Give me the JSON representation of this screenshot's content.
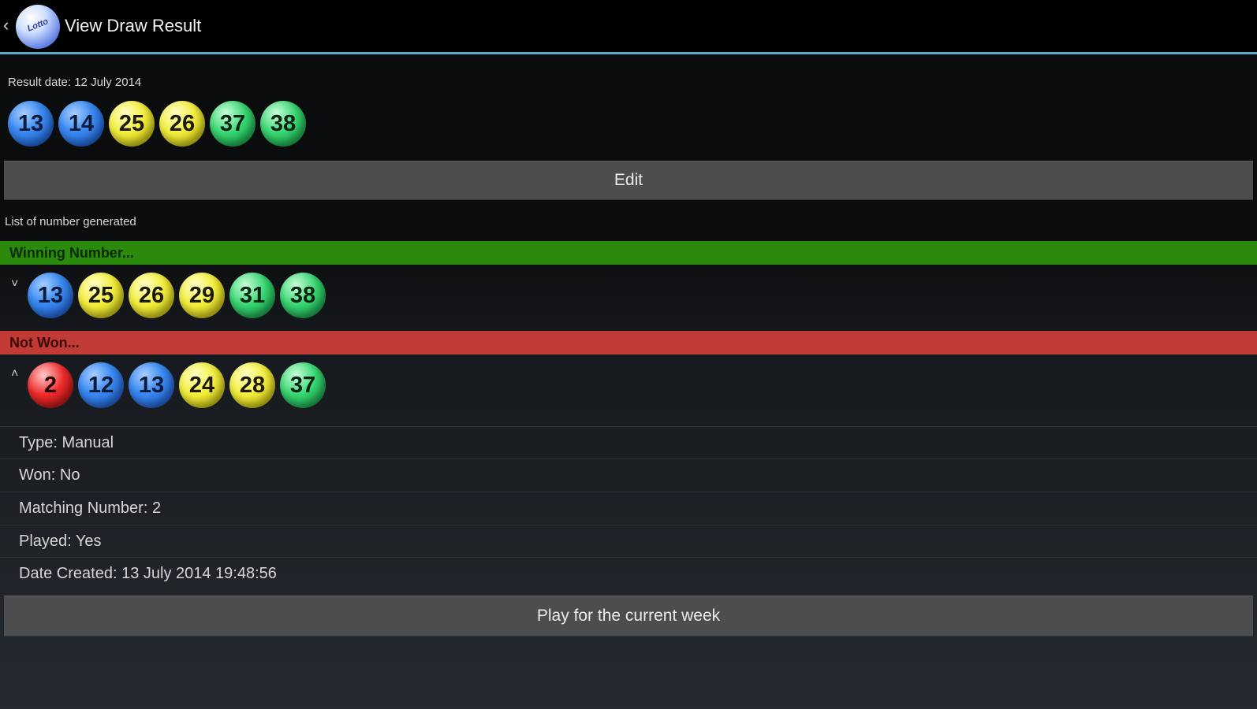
{
  "action_bar": {
    "title": "View Draw Result",
    "logo_text": "Lotto"
  },
  "result": {
    "date_label": "Result date: 12 July 2014",
    "balls": [
      {
        "number": "13",
        "color": "blue"
      },
      {
        "number": "14",
        "color": "blue"
      },
      {
        "number": "25",
        "color": "yellow"
      },
      {
        "number": "26",
        "color": "yellow"
      },
      {
        "number": "37",
        "color": "green"
      },
      {
        "number": "38",
        "color": "green"
      }
    ],
    "edit_label": "Edit"
  },
  "generated_list": {
    "caption": "List of number generated",
    "groups": [
      {
        "status": "Winning Number...",
        "status_color": "#2b8a0b",
        "expanded": false,
        "balls": [
          {
            "number": "13",
            "color": "blue"
          },
          {
            "number": "25",
            "color": "yellow"
          },
          {
            "number": "26",
            "color": "yellow"
          },
          {
            "number": "29",
            "color": "yellow"
          },
          {
            "number": "31",
            "color": "green"
          },
          {
            "number": "38",
            "color": "green"
          }
        ]
      },
      {
        "status": "Not Won...",
        "status_color": "#c23a35",
        "expanded": true,
        "balls": [
          {
            "number": "2",
            "color": "red"
          },
          {
            "number": "12",
            "color": "blue"
          },
          {
            "number": "13",
            "color": "blue"
          },
          {
            "number": "24",
            "color": "yellow"
          },
          {
            "number": "28",
            "color": "yellow"
          },
          {
            "number": "37",
            "color": "green"
          }
        ],
        "details": {
          "type": "Type: Manual",
          "won": "Won: No",
          "matching": "Matching Number: 2",
          "played": "Played: Yes",
          "created": "Date Created: 13 July 2014 19:48:56"
        }
      }
    ]
  },
  "play_button_label": "Play for the current week"
}
